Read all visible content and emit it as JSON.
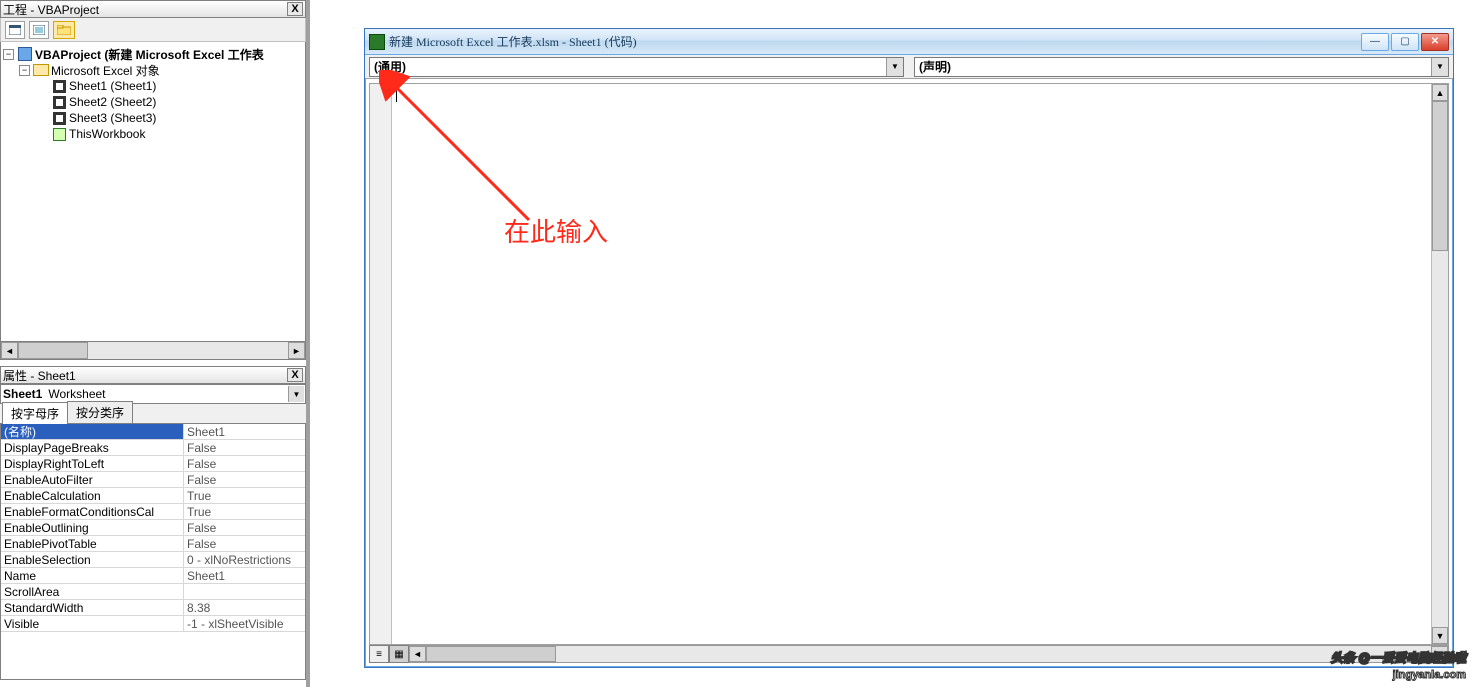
{
  "project_panel": {
    "title": "工程 - VBAProject",
    "root_label": "VBAProject (新建 Microsoft Excel 工作表",
    "folder_label": "Microsoft Excel 对象",
    "items": [
      "Sheet1 (Sheet1)",
      "Sheet2 (Sheet2)",
      "Sheet3 (Sheet3)",
      "ThisWorkbook"
    ]
  },
  "properties_panel": {
    "title": "属性 - Sheet1",
    "object_name": "Sheet1",
    "object_type": "Worksheet",
    "tabs": {
      "alpha": "按字母序",
      "category": "按分类序"
    },
    "rows": [
      {
        "name": "(名称)",
        "value": "Sheet1",
        "sel": true
      },
      {
        "name": "DisplayPageBreaks",
        "value": "False"
      },
      {
        "name": "DisplayRightToLeft",
        "value": "False"
      },
      {
        "name": "EnableAutoFilter",
        "value": "False"
      },
      {
        "name": "EnableCalculation",
        "value": "True"
      },
      {
        "name": "EnableFormatConditionsCal",
        "value": "True"
      },
      {
        "name": "EnableOutlining",
        "value": "False"
      },
      {
        "name": "EnablePivotTable",
        "value": "False"
      },
      {
        "name": "EnableSelection",
        "value": "0 - xlNoRestrictions"
      },
      {
        "name": "Name",
        "value": "Sheet1"
      },
      {
        "name": "ScrollArea",
        "value": ""
      },
      {
        "name": "StandardWidth",
        "value": "8.38"
      },
      {
        "name": "Visible",
        "value": "-1 - xlSheetVisible"
      }
    ]
  },
  "code_window": {
    "title": "新建 Microsoft Excel 工作表.xlsm - Sheet1 (代码)",
    "combo_left": "(通用)",
    "combo_right": "(声明)"
  },
  "annotation": {
    "text": "在此输入"
  },
  "watermark": {
    "line1": "头条 @一丢丢电脑经验啦",
    "line2": "jingyanla.com"
  }
}
